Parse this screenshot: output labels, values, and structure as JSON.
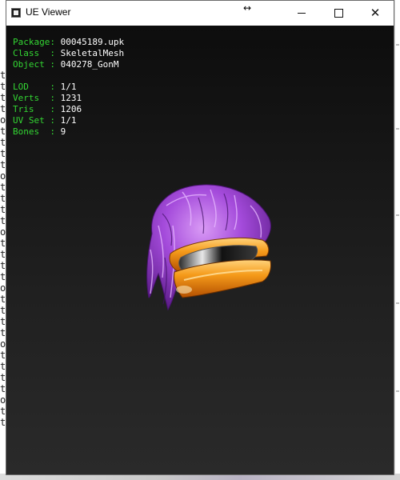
{
  "window": {
    "title": "UE Viewer"
  },
  "background_window": {
    "left_chars": [
      "t",
      "t",
      "t",
      "t",
      "o",
      "t",
      "t",
      "t",
      "t",
      "o",
      "t",
      "t",
      "t",
      "t",
      "o",
      "t",
      "t",
      "t",
      "t",
      "o",
      "t",
      "t",
      "t",
      "t",
      "o",
      "t",
      "t",
      "t",
      "t",
      "o",
      "t",
      "t"
    ]
  },
  "info_panel": {
    "package": {
      "key": "Package: ",
      "value": "00045189.upk"
    },
    "class": {
      "key": "Class  : ",
      "value": "SkeletalMesh"
    },
    "object": {
      "key": "Object : ",
      "value": "040278_GonM"
    },
    "lod": {
      "key": "LOD    : ",
      "value": "1/1"
    },
    "verts": {
      "key": "Verts  : ",
      "value": "1231"
    },
    "tris": {
      "key": "Tris   : ",
      "value": "1206"
    },
    "uvset": {
      "key": "UV Set : ",
      "value": "1/1"
    },
    "bones": {
      "key": "Bones  : ",
      "value": "9"
    }
  },
  "colors": {
    "label": "#33d633",
    "value": "#ffffff",
    "hair": "#9b3fd6",
    "cap": "#f08a10"
  },
  "icons": [
    "app-icon",
    "resize-icon",
    "minimize-icon",
    "maximize-icon",
    "close-icon"
  ]
}
